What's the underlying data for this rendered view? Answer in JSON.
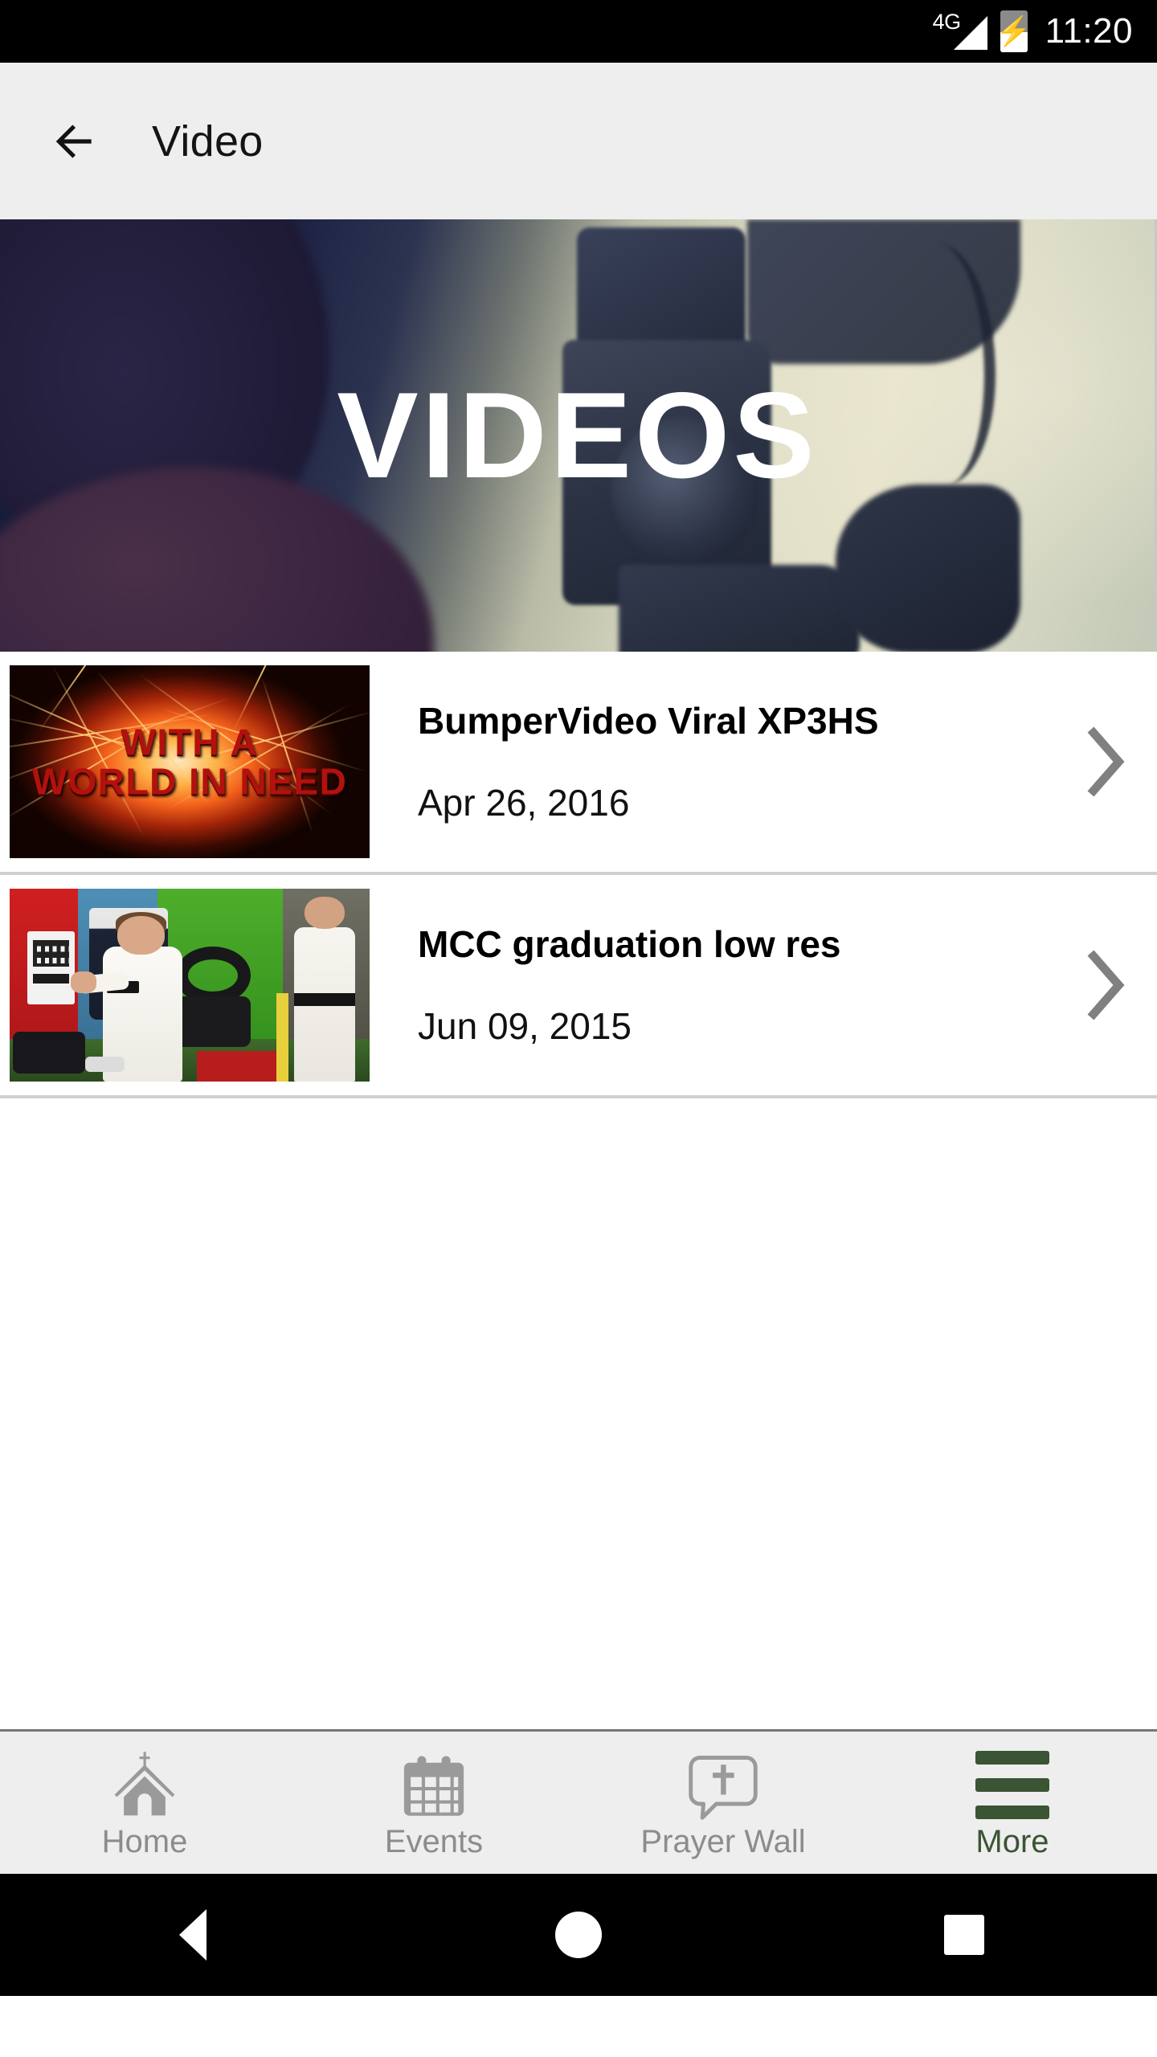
{
  "status_bar": {
    "network_label": "4G",
    "signal_icon": "signal-bars-icon",
    "battery_icon": "battery-charging-icon",
    "time": "11:20"
  },
  "app_bar": {
    "back_icon": "back-arrow-icon",
    "title": "Video"
  },
  "hero": {
    "title": "VIDEOS",
    "image_description": "video-camera-banner"
  },
  "videos": [
    {
      "title": "BumperVideo Viral XP3HS",
      "date": "Apr 26, 2016",
      "thumbnail_text_line1": "WITH A",
      "thumbnail_text_line2": "WORLD IN NEED",
      "chevron_icon": "chevron-right-icon"
    },
    {
      "title": "MCC graduation low res",
      "date": "Jun 09, 2015",
      "chevron_icon": "chevron-right-icon"
    }
  ],
  "tab_bar": {
    "items": [
      {
        "label": "Home",
        "icon": "church-icon",
        "active": false
      },
      {
        "label": "Events",
        "icon": "calendar-icon",
        "active": false
      },
      {
        "label": "Prayer Wall",
        "icon": "prayer-bubble-icon",
        "active": false
      },
      {
        "label": "More",
        "icon": "hamburger-menu-icon",
        "active": true
      }
    ],
    "active_color": "#3a5434",
    "inactive_color": "#8c8c8c"
  },
  "system_nav": {
    "back_icon": "triangle-back-icon",
    "home_icon": "circle-home-icon",
    "recents_icon": "square-recents-icon"
  }
}
